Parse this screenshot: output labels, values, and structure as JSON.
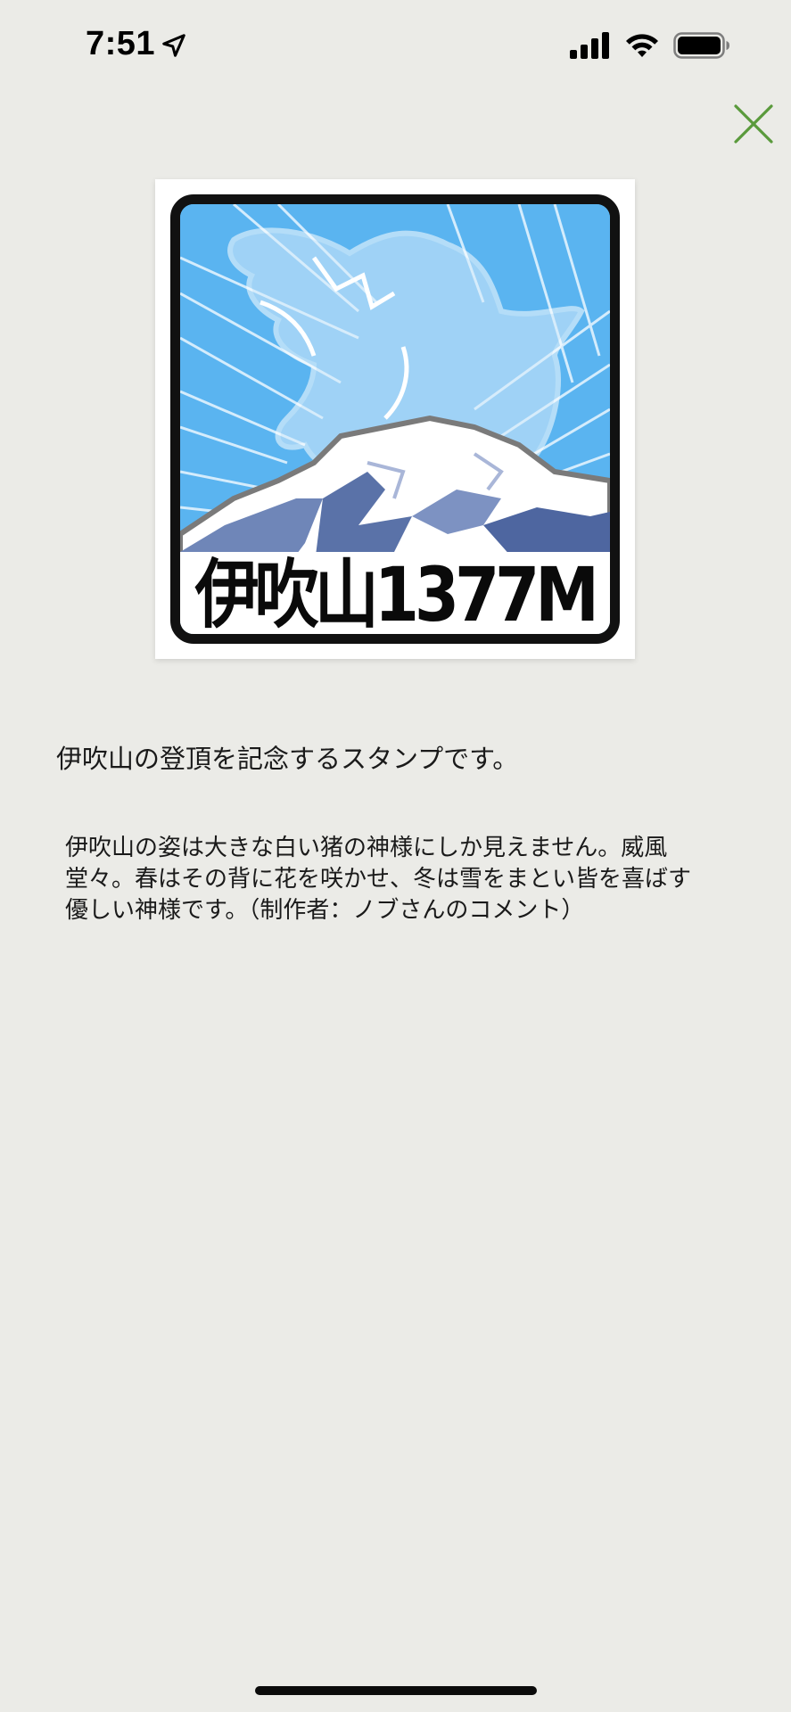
{
  "status_bar": {
    "time": "7:51",
    "icons": [
      "location-arrow-icon",
      "cellular-signal-icon",
      "wifi-icon",
      "battery-icon"
    ]
  },
  "header": {
    "close_icon": "close-icon",
    "close_color": "#5a9a3c"
  },
  "stamp": {
    "label": "伊吹山1377M",
    "sky_color": "#5ab4f0",
    "frame_color": "#111111"
  },
  "content": {
    "headline": "伊吹山の登頂を記念するスタンプです。",
    "comment": "伊吹山の姿は大きな白い猪の神様にしか見えません。威風\n堂々。春はその背に花を咲かせ、冬は雪をまとい皆を喜ばす\n優しい神様です。（制作者：ノブさんのコメント）"
  }
}
